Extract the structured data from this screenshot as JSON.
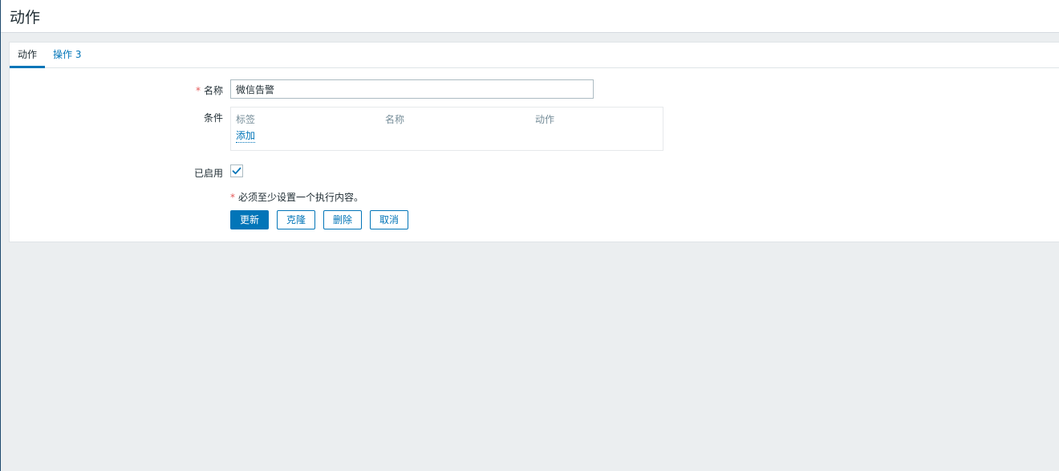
{
  "header": {
    "title": "动作"
  },
  "tabs": [
    {
      "label": "动作",
      "active": true
    },
    {
      "label": "操作 3",
      "active": false
    }
  ],
  "form": {
    "required_marker": "*",
    "name": {
      "label": "名称",
      "value": "微信告警"
    },
    "conditions": {
      "label": "条件",
      "columns": [
        "标签",
        "名称",
        "动作"
      ],
      "add_link": "添加"
    },
    "enabled": {
      "label": "已启用",
      "checked": true
    },
    "note": "必须至少设置一个执行内容。"
  },
  "buttons": {
    "update": "更新",
    "clone": "克隆",
    "delete": "删除",
    "cancel": "取消"
  },
  "colors": {
    "accent": "#0275b8",
    "required": "#e45959",
    "background": "#ebeef0"
  }
}
